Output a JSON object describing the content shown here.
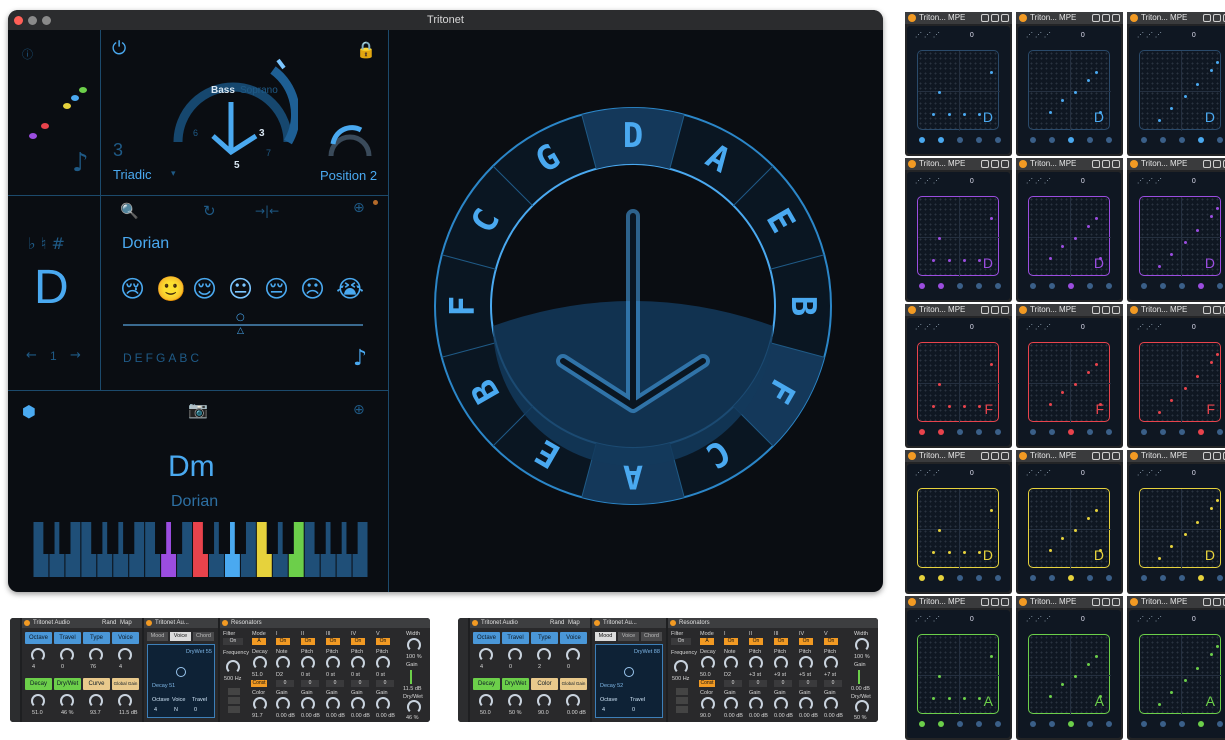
{
  "window": {
    "title": "Tritonet",
    "voicing": {
      "count": "3",
      "type": "Triadic",
      "bass_label": "Bass",
      "soprano_label": "Soprano",
      "num_3": "3",
      "num_5": "5",
      "num_6": "6",
      "num_7": "7",
      "position": "Position 2"
    },
    "mode_panel": {
      "accidentals": "♭ ♮ #",
      "root": "D",
      "mode_name": "Dorian",
      "scale_notes": "DEFGABC",
      "nav_value": "1",
      "moods": [
        "😢",
        "🙂",
        "😌",
        "😐",
        "😔",
        "☹",
        "😭"
      ]
    },
    "chord_panel": {
      "chord": "Dm",
      "mode": "Dorian"
    },
    "wheel": {
      "letters": [
        "D",
        "A",
        "E",
        "B",
        "F",
        "C",
        "A",
        "E",
        "B",
        "F",
        "C",
        "G"
      ]
    },
    "colors": {
      "accent": "#4aa9f0",
      "bg": "#0a0d12"
    }
  },
  "grid": {
    "header_title": "Triton... MPE",
    "cells": [
      {
        "note": "D",
        "color": "#4aa9f0",
        "row_value": "0"
      },
      {
        "note": "D",
        "color": "#4aa9f0",
        "row_value": "0"
      },
      {
        "note": "D",
        "color": "#4aa9f0",
        "row_value": "0"
      },
      {
        "note": "D",
        "color": "#9b4de0",
        "row_value": "0"
      },
      {
        "note": "D",
        "color": "#9b4de0",
        "row_value": "0"
      },
      {
        "note": "D",
        "color": "#9b4de0",
        "row_value": "0"
      },
      {
        "note": "F",
        "color": "#e8434c",
        "row_value": "0"
      },
      {
        "note": "F",
        "color": "#e8434c",
        "row_value": "0"
      },
      {
        "note": "F",
        "color": "#e8434c",
        "row_value": "0"
      },
      {
        "note": "D",
        "color": "#e6d23c",
        "row_value": "0"
      },
      {
        "note": "D",
        "color": "#e6d23c",
        "row_value": "0"
      },
      {
        "note": "D",
        "color": "#e6d23c",
        "row_value": "0"
      },
      {
        "note": "A",
        "color": "#6ccf4a",
        "row_value": "0"
      },
      {
        "note": "A",
        "color": "#6ccf4a",
        "row_value": "0"
      },
      {
        "note": "A",
        "color": "#6ccf4a",
        "row_value": "0"
      }
    ]
  },
  "devices": [
    {
      "audio_title": "Tritonet Audio",
      "rand": "Rand",
      "map": "Map",
      "tiles": [
        "Octave",
        "Travel",
        "Type",
        "Voice",
        "Decay",
        "Dry/Wet",
        "Curve",
        "Global Gain"
      ],
      "values": [
        "4",
        "0",
        "76",
        "4",
        "51.0",
        "46 %",
        "93.7",
        "11.5 dB"
      ],
      "au_title": "Tritonet Au...",
      "tabs": [
        "Mood",
        "Voice",
        "Chord"
      ],
      "drywet": "DryWet 55",
      "decay": "Decay 51",
      "au_labels": [
        "Octave",
        "Voice",
        "Travel"
      ],
      "au_values": [
        "4",
        "N",
        "0"
      ],
      "res_title": "Resonators",
      "filter": "Filter",
      "on": "On",
      "frequency": "Frequency",
      "freq_val": "500 Hz",
      "mode": "Mode",
      "mode_val": "A",
      "decay_lbl": "Decay",
      "decay_val": "51.0",
      "color_lbl": "Color",
      "color_val": "91.7",
      "cols": [
        "I",
        "II",
        "III",
        "IV",
        "V"
      ],
      "width": "Width",
      "width_val": "100 %",
      "gain": "Gain",
      "gain_val": "11.5 dB",
      "drywet_lbl": "Dry/Wet",
      "drywet_val": "46 %",
      "const": "Const",
      "pitch_vals": [
        "D2",
        "0 st",
        "0 st",
        "0 st",
        "0 st"
      ],
      "gain_vals": [
        "0.00 dB",
        "0.00 dB",
        "0.00 dB",
        "0.00 dB",
        "0.00 dB"
      ],
      "note_lbl": "Note",
      "pitch_lbl": "Pitch",
      "gain_lbl": "Gain",
      "on_lbl": "On"
    },
    {
      "audio_title": "Tritonet Audio",
      "rand": "Rand",
      "map": "Map",
      "tiles": [
        "Octave",
        "Travel",
        "Type",
        "Voice",
        "Decay",
        "Dry/Wet",
        "Color",
        "Global Gain"
      ],
      "values": [
        "4",
        "0",
        "2",
        "0",
        "50.0",
        "50 %",
        "90.0",
        "0.00 dB"
      ],
      "au_title": "Tritonet Au...",
      "tabs": [
        "Mood",
        "Voice",
        "Chord"
      ],
      "drywet": "DryWet 88",
      "decay": "Decay 52",
      "au_labels": [
        "Octave",
        "Travel"
      ],
      "au_values": [
        "4",
        "0"
      ],
      "res_title": "Resonators",
      "filter": "Filter",
      "on": "On",
      "frequency": "Frequency",
      "freq_val": "500 Hz",
      "mode": "Mode",
      "mode_val": "A",
      "decay_lbl": "Decay",
      "decay_val": "50.0",
      "color_lbl": "Color",
      "color_val": "90.0",
      "cols": [
        "I",
        "II",
        "III",
        "IV",
        "V"
      ],
      "width": "Width",
      "width_val": "100 %",
      "gain": "Gain",
      "gain_val": "0.00 dB",
      "drywet_lbl": "Dry/Wet",
      "drywet_val": "50 %",
      "const": "Const",
      "pitch_vals": [
        "D2",
        "+3 st",
        "+9 st",
        "+5 st",
        "+7 st"
      ],
      "gain_vals": [
        "0.00 dB",
        "0.00 dB",
        "0.00 dB",
        "0.00 dB",
        "0.00 dB"
      ],
      "note_lbl": "Note",
      "pitch_lbl": "Pitch",
      "gain_lbl": "Gain",
      "on_lbl": "On"
    }
  ]
}
